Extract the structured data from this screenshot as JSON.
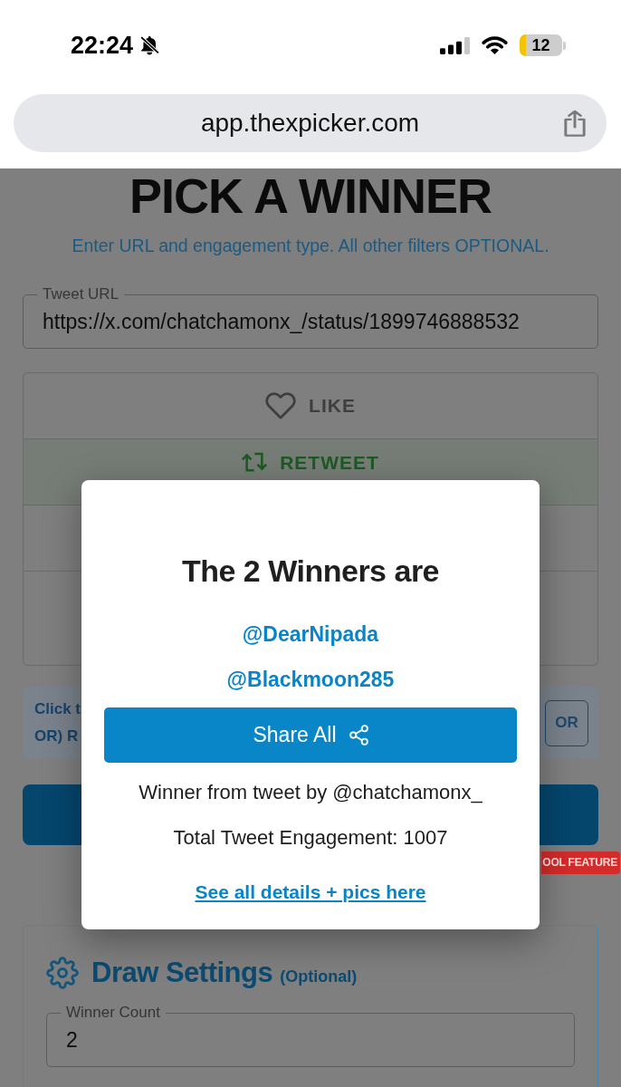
{
  "status_bar": {
    "time": "22:24",
    "silent": true,
    "battery_text": "12",
    "low_power_mode": true
  },
  "browser": {
    "url": "app.thexpicker.com"
  },
  "page": {
    "title": "PICK A WINNER",
    "subtitle": "Enter URL and engagement type. All other filters OPTIONAL.",
    "tweet_url_field": {
      "label": "Tweet URL",
      "value": "https://x.com/chatchamonx_/status/1899746888532"
    },
    "engagement_options": [
      {
        "kind": "like",
        "label": "LIKE",
        "selected": false
      },
      {
        "kind": "retweet",
        "label": "RETWEET",
        "selected": true
      }
    ],
    "info_box": {
      "lines": [
        "Click t",
        "OR) R"
      ],
      "or_button": "OR"
    },
    "feature_badge": "OOL FEATURE",
    "draw_settings": {
      "title": "Draw Settings",
      "note": "(Optional)",
      "winner_count_field": {
        "label": "Winner Count",
        "value": "2"
      }
    }
  },
  "dialog": {
    "title": "The 2 Winners are",
    "winners": [
      "@DearNipada",
      "@Blackmoon285"
    ],
    "share_button": "Share All",
    "author_text": "Winner from tweet by @chatchamonx_",
    "engagement_text": "Total Tweet Engagement: 1007",
    "details_link": "See all details + pics here"
  }
}
